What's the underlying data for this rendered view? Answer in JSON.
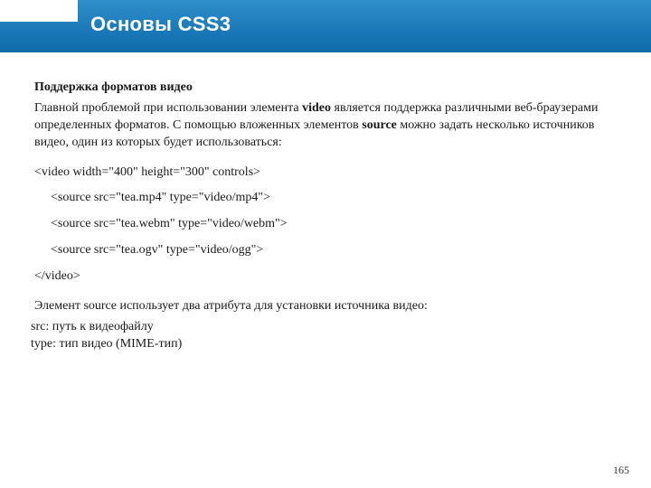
{
  "title": "Основы CSS3",
  "subheading": "Поддержка форматов видео",
  "intro_a": "Главной проблемой при использовании элемента ",
  "intro_b": "video",
  "intro_c": " является поддержка различными веб-браузерами определенных форматов. С помощью вложенных элементов ",
  "intro_d": "source",
  "intro_e": " можно задать несколько источников видео, один из которых будет использоваться:",
  "code": {
    "l1": "<video width=\"400\" height=\"300\" controls>",
    "l2": "<source src=\"tea.mp4\" type=\"video/mp4\">",
    "l3": "<source src=\"tea.webm\" type=\"video/webm\">",
    "l4": "<source src=\"tea.ogv\" type=\"video/ogg\">",
    "l5": "</video>"
  },
  "attrs_intro": "Элемент source использует два атрибута для установки источника видео:",
  "attr1": "src: путь к видеофайлу",
  "attr2": "type: тип видео (MIME-тип)",
  "page_number": "165"
}
